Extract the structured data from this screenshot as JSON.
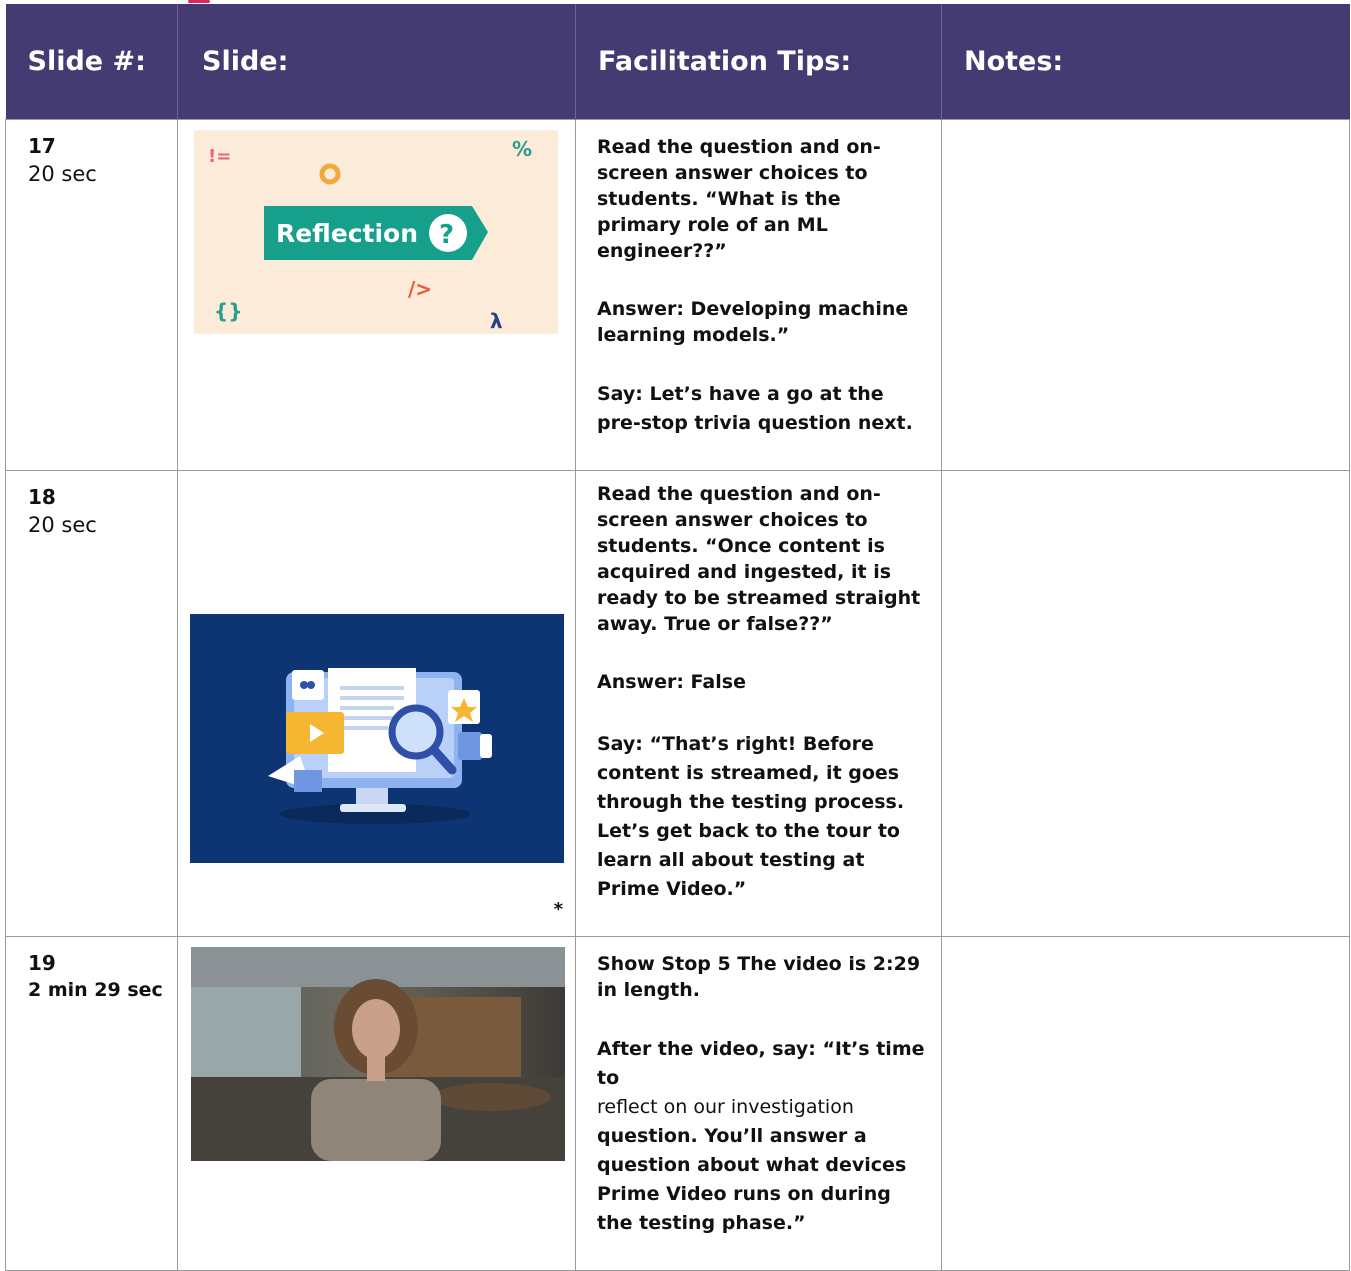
{
  "headers": {
    "slide_num": "Slide #:",
    "slide": "Slide:",
    "tips": "Facilitation Tips:",
    "notes": "Notes:"
  },
  "rows": [
    {
      "number": "17",
      "duration": "20 sec",
      "slide_label": "Reflection",
      "tips": [
        "Read the question and on-screen answer choices to students. “What is the primary role of an ML engineer??”",
        "Answer: Developing machine learning models.”",
        "Say: Let’s have a go at the pre-stop trivia question next."
      ]
    },
    {
      "number": "18",
      "duration": "20 sec",
      "footnote": "*",
      "tips": [
        "Read the question and on-screen answer choices to students. “Once content is acquired and ingested, it is ready to be streamed straight away. True or false??”",
        "Answer: False",
        "Say: “That’s right! Before content is streamed, it goes through the testing process. Let’s get back to the tour to learn all about testing at Prime Video.”"
      ]
    },
    {
      "number": "19",
      "duration": "2 min 29 sec",
      "tips": [
        "Show Stop 5 The video is 2:29 in length."
      ],
      "tip_after_bold": "After the video, say: “It’s time to",
      "tip_after_regular": "reflect on our investigation",
      "tip_after_rest": "question. You’ll answer a question about what devices Prime Video runs on during the testing phase.”"
    }
  ],
  "colors": {
    "header_bg": "#433b72",
    "header_text": "#ffffff",
    "reflection_bg": "#fdebd9",
    "reflection_banner": "#16a08c",
    "slide18_bg": "#0d3574"
  }
}
